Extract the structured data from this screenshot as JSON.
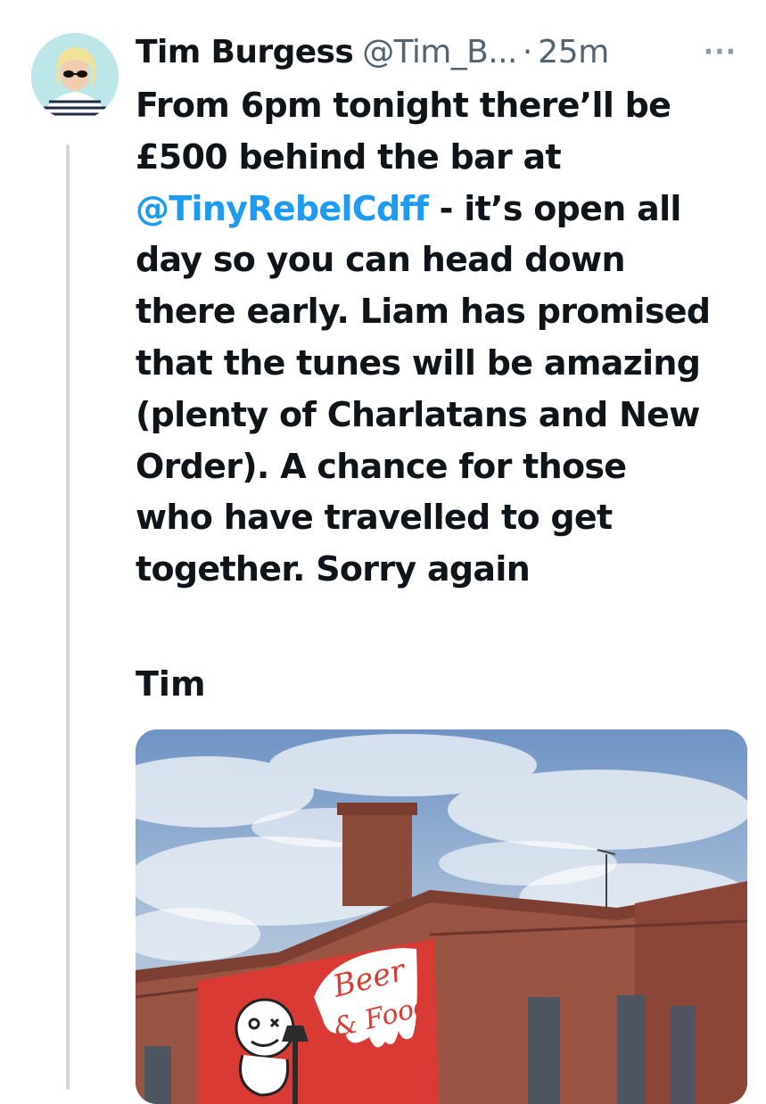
{
  "tweet": {
    "display_name": "Tim Burgess",
    "handle": "@Tim_B...",
    "separator": "·",
    "time": "25m",
    "more_glyph": "···",
    "text_lines": [
      {
        "text": "From 6pm tonight there’ll be"
      },
      {
        "text": "£500 behind the bar at"
      },
      {
        "mention": "@TinyRebelCdff",
        "text": " - it’s open all"
      },
      {
        "text": "day so you can head down"
      },
      {
        "text": "there early. Liam has promised"
      },
      {
        "text": "that the tunes will be amazing"
      },
      {
        "text": "(plenty of Charlatans and New"
      },
      {
        "text": "Order). A chance for those"
      },
      {
        "text": "who have travelled to get"
      },
      {
        "text": "together. Sorry again"
      }
    ],
    "sign_off": "Tim",
    "media": {
      "banner_text_1": "Beer",
      "banner_text_2": "& Food"
    }
  },
  "colors": {
    "mention": "#1d9bf0",
    "secondary_text": "#536471",
    "thread_line": "#cfd9de"
  }
}
